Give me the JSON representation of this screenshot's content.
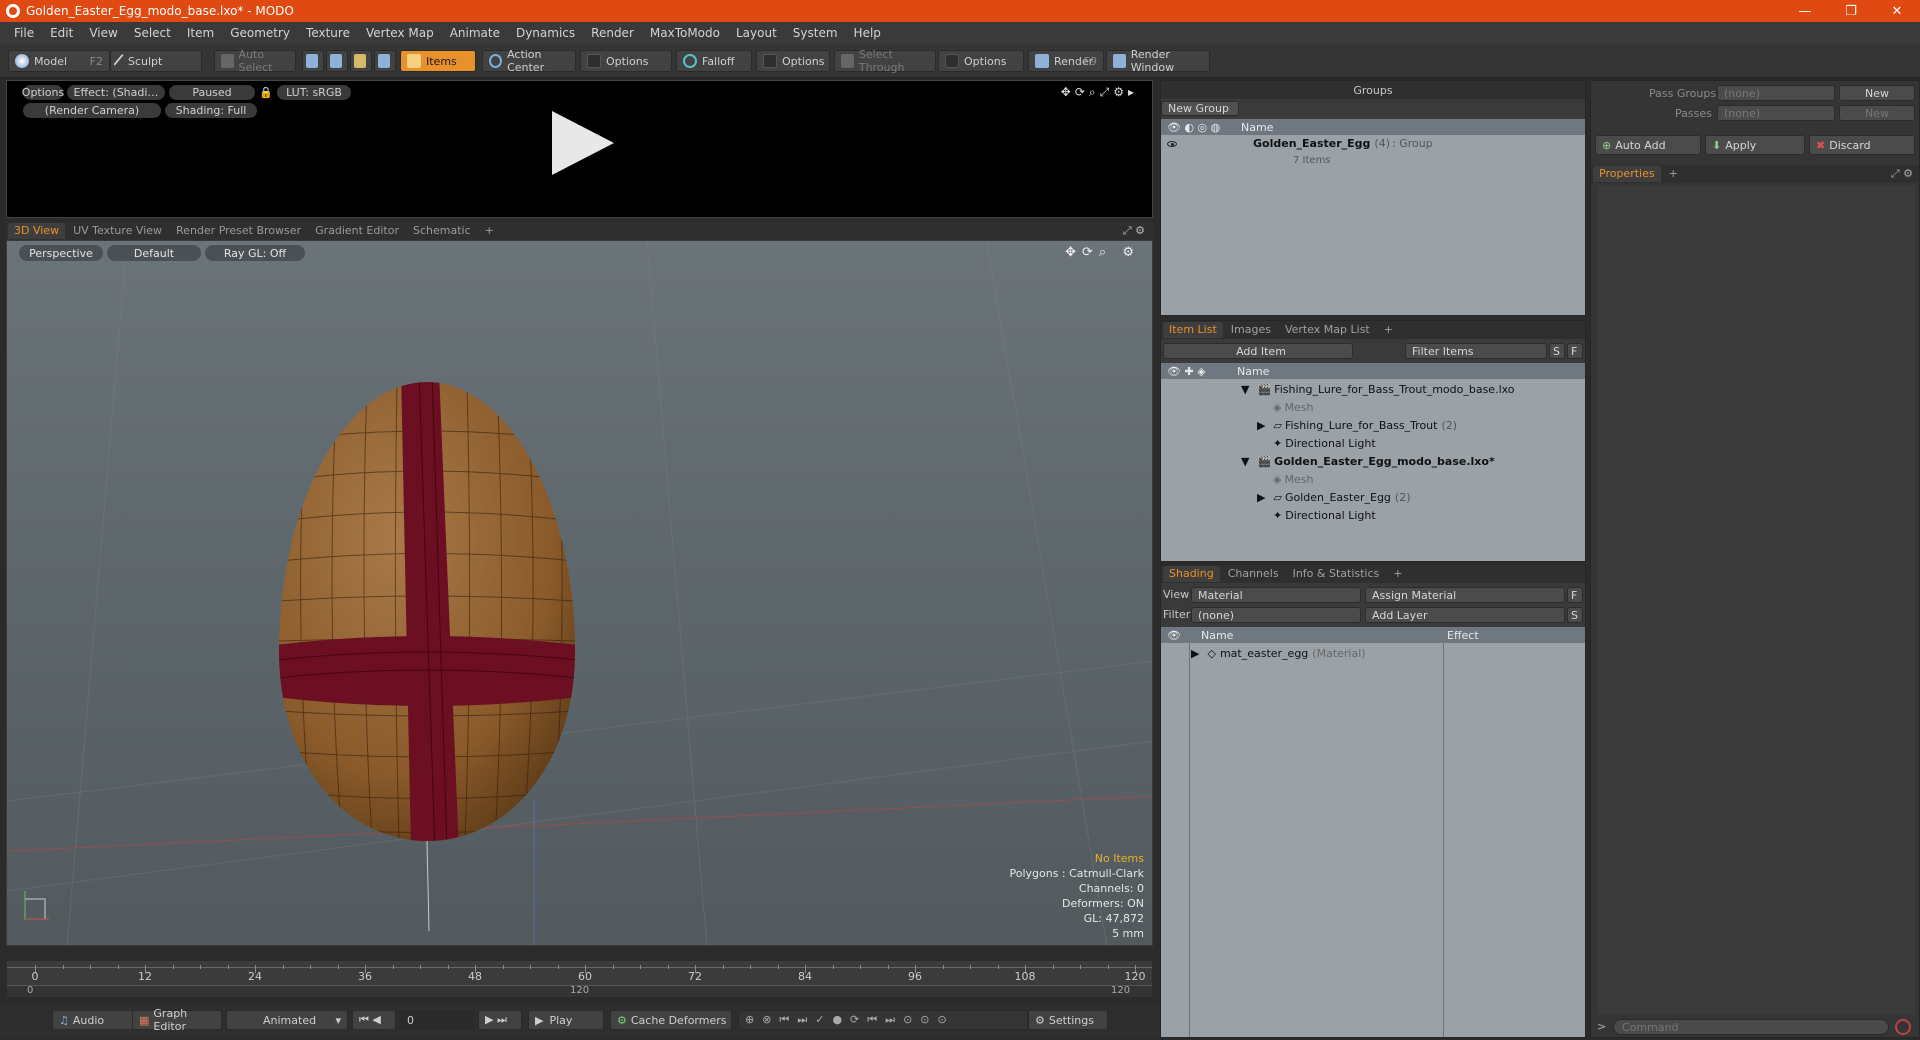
{
  "window": {
    "title": "Golden_Easter_Egg_modo_base.lxo* - MODO",
    "controls": [
      "—",
      "❐",
      "✕"
    ]
  },
  "menu": [
    "File",
    "Edit",
    "View",
    "Select",
    "Item",
    "Geometry",
    "Texture",
    "Vertex Map",
    "Animate",
    "Dynamics",
    "Render",
    "MaxToModo",
    "Layout",
    "System",
    "Help"
  ],
  "toolbar": {
    "model": "Model",
    "model_key": "F2",
    "sculpt": "Sculpt",
    "auto_select": "Auto Select",
    "items": "Items",
    "action_center": "Action Center",
    "options1": "Options",
    "falloff": "Falloff",
    "options2": "Options",
    "select_through": "Select Through",
    "options3": "Options",
    "render": "Render",
    "render_key": "F9",
    "render_window": "Render Window"
  },
  "preview": {
    "options": "Options",
    "effect": "Effect: (Shadi…",
    "paused": "Paused",
    "lut": "LUT: sRGB",
    "camera": "(Render Camera)",
    "shading": "Shading: Full"
  },
  "view_tabs": [
    "3D View",
    "UV Texture View",
    "Render Preset Browser",
    "Gradient Editor",
    "Schematic",
    "+"
  ],
  "viewport": {
    "perspective": "Perspective",
    "default": "Default",
    "raygl": "Ray GL: Off",
    "stats": {
      "no_items": "No Items",
      "polygons": "Polygons : Catmull-Clark",
      "channels": "Channels: 0",
      "deformers": "Deformers: ON",
      "gl": "GL: 47,872",
      "unit": "5 mm"
    }
  },
  "timeline": {
    "ticks": [
      "0",
      "12",
      "24",
      "36",
      "48",
      "60",
      "72",
      "84",
      "96",
      "108",
      "120"
    ],
    "sub_start": "0",
    "sub_mid": "120",
    "sub_end": "120"
  },
  "transport": {
    "audio": "Audio",
    "graph_editor": "Graph Editor",
    "animated": "Animated",
    "frame": "0",
    "play": "Play",
    "cache": "Cache Deformers",
    "settings": "Settings"
  },
  "groups": {
    "title": "Groups",
    "new_group": "New Group",
    "col_name": "Name",
    "item_name": "Golden_Easter_Egg",
    "item_count": "(4)",
    "item_type": ": Group",
    "item_sub": "7 Items"
  },
  "item_list": {
    "tabs": [
      "Item List",
      "Images",
      "Vertex Map List",
      "+"
    ],
    "add_item": "Add Item",
    "filter": "Filter Items",
    "s": "S",
    "f": "F",
    "col_name": "Name",
    "rows": [
      {
        "label": "Fishing_Lure_for_Bass_Trout_modo_base.lxo",
        "extra": ""
      },
      {
        "label": "Mesh",
        "extra": ""
      },
      {
        "label": "Fishing_Lure_for_Bass_Trout",
        "extra": "(2)"
      },
      {
        "label": "Directional Light",
        "extra": ""
      },
      {
        "label": "Golden_Easter_Egg_modo_base.lxo*",
        "extra": ""
      },
      {
        "label": "Mesh",
        "extra": ""
      },
      {
        "label": "Golden_Easter_Egg",
        "extra": "(2)"
      },
      {
        "label": "Directional Light",
        "extra": ""
      }
    ]
  },
  "shading": {
    "tabs": [
      "Shading",
      "Channels",
      "Info & Statistics",
      "+"
    ],
    "view_label": "View",
    "view_value": "Material",
    "assign": "Assign Material",
    "f": "F",
    "filter_label": "Filter",
    "filter_value": "(none)",
    "add_layer": "Add Layer",
    "s": "S",
    "col_name": "Name",
    "col_effect": "Effect",
    "row_name": "mat_easter_egg",
    "row_type": "(Material)"
  },
  "properties": {
    "pass_groups_label": "Pass Groups",
    "pass_groups_value": "(none)",
    "new1": "New",
    "passes_label": "Passes",
    "passes_value": "(none)",
    "new2": "New",
    "auto_add": "Auto Add",
    "apply": "Apply",
    "discard": "Discard",
    "tab": "Properties",
    "plus": "+",
    "command_placeholder": "Command"
  },
  "colors": {
    "accent": "#e8902a",
    "titlebar": "#e04a12",
    "egg": "#8a5a2a",
    "ribbon": "#6d0f22"
  }
}
